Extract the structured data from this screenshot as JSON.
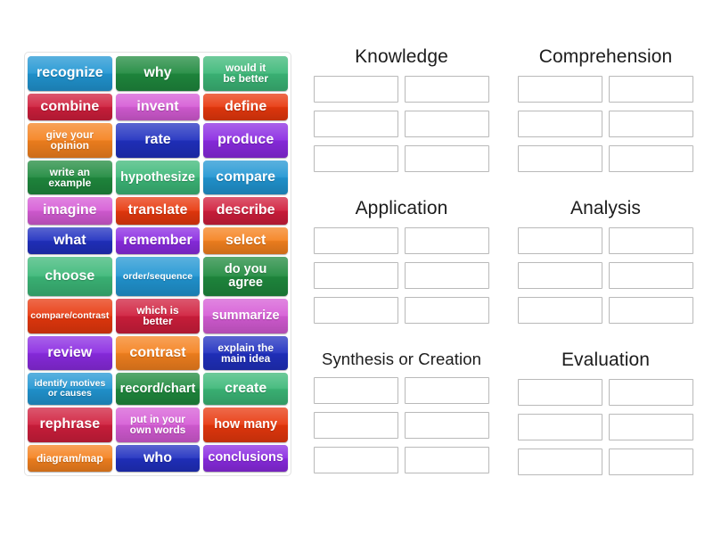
{
  "activity": {
    "type": "group-sort",
    "tile_columns": 3,
    "tile_rows": 13
  },
  "tiles": [
    {
      "label": "recognize",
      "color": "#2196d3",
      "size": "fs-lg"
    },
    {
      "label": "why",
      "color": "#1f8a3e",
      "size": "fs-lg"
    },
    {
      "label": "would it\nbe better",
      "color": "#3cb878",
      "size": "fs-sm"
    },
    {
      "label": "combine",
      "color": "#d01e3c",
      "size": "fs-lg"
    },
    {
      "label": "invent",
      "color": "#d65cd6",
      "size": "fs-lg"
    },
    {
      "label": "define",
      "color": "#e8380d",
      "size": "fs-lg"
    },
    {
      "label": "give your\nopinion",
      "color": "#f5821f",
      "size": "fs-sm"
    },
    {
      "label": "rate",
      "color": "#2030c0",
      "size": "fs-lg"
    },
    {
      "label": "produce",
      "color": "#8b2be2",
      "size": "fs-lg"
    },
    {
      "label": "write an\nexample",
      "color": "#1f8a3e",
      "size": "fs-sm"
    },
    {
      "label": "hypothesize",
      "color": "#3cb878",
      "size": "fs-md"
    },
    {
      "label": "compare",
      "color": "#2196d3",
      "size": "fs-lg"
    },
    {
      "label": "imagine",
      "color": "#d65cd6",
      "size": "fs-lg"
    },
    {
      "label": "translate",
      "color": "#e8380d",
      "size": "fs-lg"
    },
    {
      "label": "describe",
      "color": "#d01e3c",
      "size": "fs-lg"
    },
    {
      "label": "what",
      "color": "#2030c0",
      "size": "fs-lg"
    },
    {
      "label": "remember",
      "color": "#8b2be2",
      "size": "fs-lg"
    },
    {
      "label": "select",
      "color": "#f5821f",
      "size": "fs-lg"
    },
    {
      "label": "choose",
      "color": "#3cb878",
      "size": "fs-lg"
    },
    {
      "label": "order/sequence",
      "color": "#2196d3",
      "size": "fs-xs"
    },
    {
      "label": "do you agree",
      "color": "#1f8a3e",
      "size": "fs-md"
    },
    {
      "label": "compare/contrast",
      "color": "#e8380d",
      "size": "fs-xs"
    },
    {
      "label": "which is\nbetter",
      "color": "#d01e3c",
      "size": "fs-sm"
    },
    {
      "label": "summarize",
      "color": "#d65cd6",
      "size": "fs-md"
    },
    {
      "label": "review",
      "color": "#8b2be2",
      "size": "fs-lg"
    },
    {
      "label": "contrast",
      "color": "#f5821f",
      "size": "fs-lg"
    },
    {
      "label": "explain the\nmain idea",
      "color": "#2030c0",
      "size": "fs-sm"
    },
    {
      "label": "identify motives\nor causes",
      "color": "#2196d3",
      "size": "fs-xs"
    },
    {
      "label": "record/chart",
      "color": "#1f8a3e",
      "size": "fs-md"
    },
    {
      "label": "create",
      "color": "#3cb878",
      "size": "fs-lg"
    },
    {
      "label": "rephrase",
      "color": "#d01e3c",
      "size": "fs-lg"
    },
    {
      "label": "put in your\nown words",
      "color": "#d65cd6",
      "size": "fs-sm"
    },
    {
      "label": "how many",
      "color": "#e8380d",
      "size": "fs-md"
    },
    {
      "label": "diagram/map",
      "color": "#f5821f",
      "size": "fs-sm"
    },
    {
      "label": "who",
      "color": "#2030c0",
      "size": "fs-lg"
    },
    {
      "label": "conclusions",
      "color": "#8b2be2",
      "size": "fs-md"
    }
  ],
  "groups": [
    {
      "title": "Knowledge",
      "slots": 6,
      "narrow": false
    },
    {
      "title": "Comprehension",
      "slots": 6,
      "narrow": false
    },
    {
      "title": "Application",
      "slots": 6,
      "narrow": false
    },
    {
      "title": "Analysis",
      "slots": 6,
      "narrow": false
    },
    {
      "title": "Synthesis or Creation",
      "slots": 6,
      "narrow": true
    },
    {
      "title": "Evaluation",
      "slots": 6,
      "narrow": false
    }
  ]
}
